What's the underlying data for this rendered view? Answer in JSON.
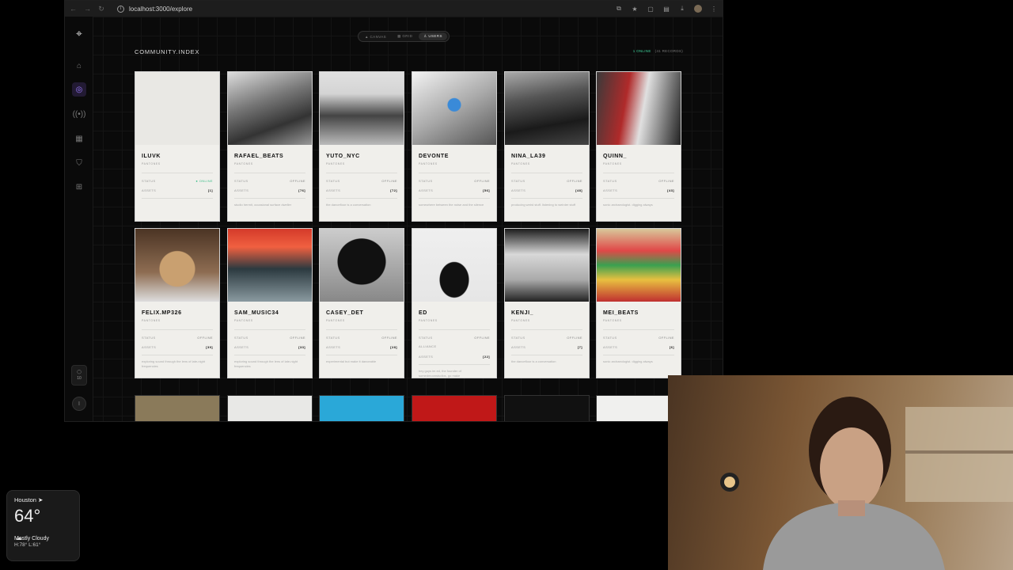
{
  "browser": {
    "url": "localhost:3000/explore"
  },
  "view_tabs": [
    {
      "label": "CANVAS",
      "icon": "canvas-icon",
      "active": false
    },
    {
      "label": "GRID",
      "icon": "grid-icon",
      "active": false
    },
    {
      "label": "USERS",
      "icon": "users-icon",
      "active": true
    }
  ],
  "page": {
    "title": "COMMUNITY.INDEX",
    "online": "1 ONLINE",
    "records": "(41 RECORDS)"
  },
  "sidebar": {
    "items": [
      {
        "name": "logo",
        "icon": "crosshair-logo-icon"
      },
      {
        "name": "home",
        "icon": "home-icon"
      },
      {
        "name": "explore",
        "icon": "compass-icon",
        "active": true
      },
      {
        "name": "broadcast",
        "icon": "broadcast-icon"
      },
      {
        "name": "calendar",
        "icon": "calendar-icon"
      },
      {
        "name": "shield",
        "icon": "shield-icon"
      },
      {
        "name": "apps",
        "icon": "apps-grid-icon"
      }
    ],
    "counter": "10",
    "user_initial": "I"
  },
  "labels": {
    "status": "STATUS",
    "assets": "ASSETS",
    "alliance": "ALLIANCE",
    "role": "PANTONES"
  },
  "users": [
    {
      "name": "ILUVK",
      "status": "● ONLINE",
      "assets": "[1]",
      "bio": ""
    },
    {
      "name": "RAFAEL_BEATS",
      "status": "OFFLINE",
      "assets": "[76]",
      "bio": "studio hermit, occasional surface dweller"
    },
    {
      "name": "YUTO_NYC",
      "status": "OFFLINE",
      "assets": "[72]",
      "bio": "the dancefloor is a conversation"
    },
    {
      "name": "DEVONTE",
      "status": "OFFLINE",
      "assets": "[56]",
      "bio": "somewhere between the noise and the silence"
    },
    {
      "name": "NINA_LA39",
      "status": "OFFLINE",
      "assets": "[48]",
      "bio": "producing weird stuff. listening to weirder stuff"
    },
    {
      "name": "QUINN_",
      "status": "OFFLINE",
      "assets": "[43]",
      "bio": "sonic archaeologist. digging always"
    },
    {
      "name": "FELIX.MP326",
      "status": "OFFLINE",
      "assets": "[39]",
      "bio": "exploring sound through the lens of late-night frequencies"
    },
    {
      "name": "SAM_MUSIC34",
      "status": "OFFLINE",
      "assets": "[33]",
      "bio": "exploring sound through the lens of late-night frequencies"
    },
    {
      "name": "CASEY_DET",
      "status": "OFFLINE",
      "assets": "[28]",
      "bio": "experimental but make it danceable"
    },
    {
      "name": "ED",
      "status": "OFFLINE",
      "alliance": "",
      "assets": "[22]",
      "bio": "hey guys im ed, the founder of somedmoonstudios, go make"
    },
    {
      "name": "KENJI_",
      "status": "OFFLINE",
      "assets": "[7]",
      "bio": "the dancefloor is a conversation"
    },
    {
      "name": "MEI_BEATS",
      "status": "OFFLINE",
      "assets": "[6]",
      "bio": "sonic archaeologist. digging always"
    }
  ],
  "weather": {
    "city": "Houston",
    "temp": "64°",
    "condition": "Mostly Cloudy",
    "hilo": "H:78° L:61°"
  },
  "colors": {
    "accent": "#9b7cff",
    "online": "#3fd19a",
    "card_bg": "#f0efeb"
  }
}
